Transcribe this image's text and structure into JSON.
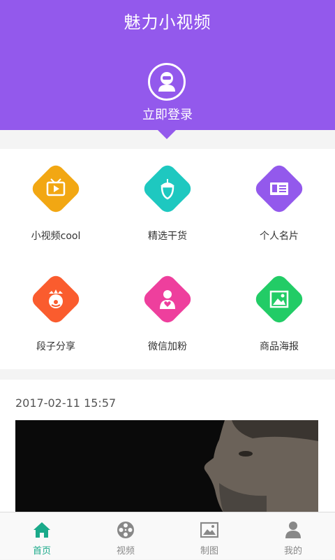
{
  "header": {
    "title": "魅力小视频",
    "login_label": "立即登录",
    "color": "#9359ec"
  },
  "menu": [
    {
      "label": "小视频cool",
      "icon": "tv-icon",
      "color": "#f2a713"
    },
    {
      "label": "精选干货",
      "icon": "acorn-icon",
      "color": "#1ec8c0"
    },
    {
      "label": "个人名片",
      "icon": "id-card-icon",
      "color": "#9359ec"
    },
    {
      "label": "段子分享",
      "icon": "clown-icon",
      "color": "#fa5c2e"
    },
    {
      "label": "微信加粉",
      "icon": "person-heart-icon",
      "color": "#ee3f9d"
    },
    {
      "label": "商品海报",
      "icon": "picture-icon",
      "color": "#22cc66"
    }
  ],
  "feed": {
    "date": "2017-02-11 15:57"
  },
  "tabs": [
    {
      "label": "首页",
      "icon": "home-icon",
      "active": true
    },
    {
      "label": "视频",
      "icon": "film-reel-icon",
      "active": false
    },
    {
      "label": "制图",
      "icon": "image-icon",
      "active": false
    },
    {
      "label": "我的",
      "icon": "user-icon",
      "active": false
    }
  ],
  "colors": {
    "tab_active": "#1aaa8a",
    "tab_inactive": "#888888"
  }
}
